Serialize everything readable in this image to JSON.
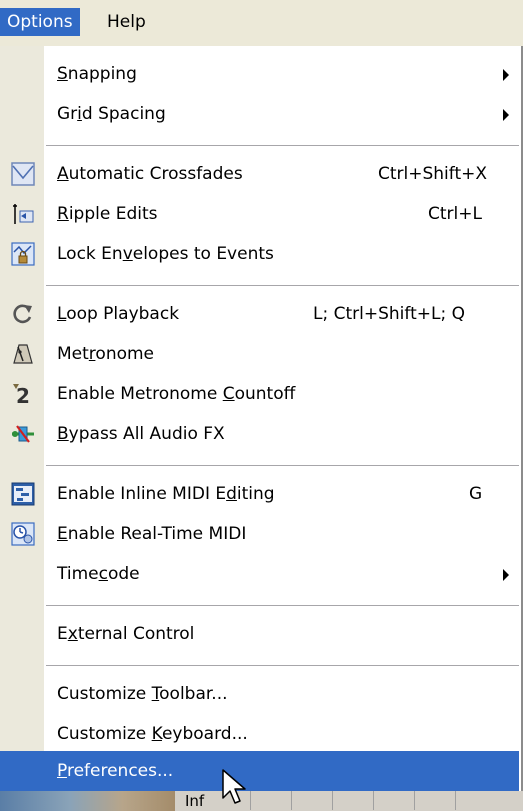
{
  "menubar": {
    "options_label": "Options",
    "help_label": "Help"
  },
  "menu": {
    "items": [
      {
        "pre": "",
        "ul": "S",
        "post": "napping",
        "shortcut": "",
        "submenu": true,
        "icon": ""
      },
      {
        "pre": "Gr",
        "ul": "i",
        "post": "d Spacing",
        "shortcut": "",
        "submenu": true,
        "icon": ""
      },
      {
        "pre": "",
        "ul": "A",
        "post": "utomatic Crossfades",
        "shortcut": "Ctrl+Shift+X",
        "submenu": false,
        "icon": "crossfade-icon"
      },
      {
        "pre": "",
        "ul": "R",
        "post": "ipple Edits",
        "shortcut": "Ctrl+L",
        "submenu": false,
        "icon": "ripple-icon"
      },
      {
        "pre": "Lock En",
        "ul": "v",
        "post": "elopes to Events",
        "shortcut": "",
        "submenu": false,
        "icon": "envelope-lock-icon"
      },
      {
        "pre": "",
        "ul": "L",
        "post": "oop Playback",
        "shortcut": "L; Ctrl+Shift+L; Q",
        "submenu": false,
        "icon": "loop-icon"
      },
      {
        "pre": "Met",
        "ul": "r",
        "post": "onome",
        "shortcut": "",
        "submenu": false,
        "icon": "metronome-icon"
      },
      {
        "pre": "Enable Metronome ",
        "ul": "C",
        "post": "ountoff",
        "shortcut": "",
        "submenu": false,
        "icon": "countoff-icon"
      },
      {
        "pre": "",
        "ul": "B",
        "post": "ypass All Audio FX",
        "shortcut": "",
        "submenu": false,
        "icon": "bypass-fx-icon"
      },
      {
        "pre": "Enable Inline MIDI E",
        "ul": "d",
        "post": "iting",
        "shortcut": "G",
        "submenu": false,
        "icon": "inline-midi-icon"
      },
      {
        "pre": "",
        "ul": "E",
        "post": "nable Real-Time MIDI",
        "shortcut": "",
        "submenu": false,
        "icon": "realtime-midi-icon"
      },
      {
        "pre": "Time",
        "ul": "c",
        "post": "ode",
        "shortcut": "",
        "submenu": true,
        "icon": ""
      },
      {
        "pre": "E",
        "ul": "x",
        "post": "ternal Control",
        "shortcut": "",
        "submenu": false,
        "icon": ""
      },
      {
        "pre": "Customize ",
        "ul": "T",
        "post": "oolbar...",
        "shortcut": "",
        "submenu": false,
        "icon": ""
      },
      {
        "pre": "Customize ",
        "ul": "K",
        "post": "eyboard...",
        "shortcut": "",
        "submenu": false,
        "icon": ""
      },
      {
        "pre": "",
        "ul": "P",
        "post": "references...",
        "shortcut": "",
        "submenu": false,
        "icon": "",
        "selected": true
      }
    ]
  },
  "taskbar": {
    "partial_text": "Inf"
  },
  "colors": {
    "highlight": "#316ac5",
    "menu_bg": "#ffffff",
    "icon_column": "#ebe9dc",
    "menubar_bg": "#ece9d8"
  }
}
